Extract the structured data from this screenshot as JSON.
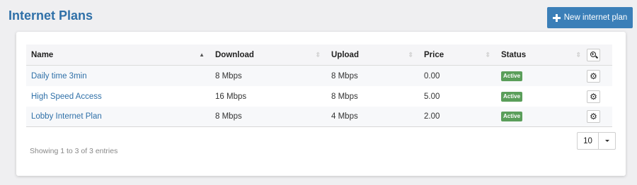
{
  "header": {
    "title": "Internet Plans",
    "new_plan_label": "New internet plan"
  },
  "table": {
    "columns": [
      "Name",
      "Download",
      "Upload",
      "Price",
      "Status"
    ],
    "sorted_column": "Name",
    "sort_direction": "ascending",
    "rows": [
      {
        "name": "Daily time 3min",
        "download": "8 Mbps",
        "upload": "8 Mbps",
        "price": "0.00",
        "status": "Active"
      },
      {
        "name": "High Speed Access",
        "download": "16 Mbps",
        "upload": "8 Mbps",
        "price": "5.00",
        "status": "Active"
      },
      {
        "name": "Lobby Internet Plan",
        "download": "8 Mbps",
        "upload": "4 Mbps",
        "price": "2.00",
        "status": "Active"
      }
    ]
  },
  "footer": {
    "info": "Showing 1 to 3 of 3 entries",
    "page_size": "10"
  },
  "colors": {
    "accent": "#3b7fb8",
    "title": "#2f70a8",
    "status_active": "#5a9e5a"
  },
  "icons": {
    "new_plan": "plus-icon",
    "row_action": "gear-icon",
    "column_filter": "zoom-in-icon",
    "page_size_toggle": "caret-down-icon"
  }
}
